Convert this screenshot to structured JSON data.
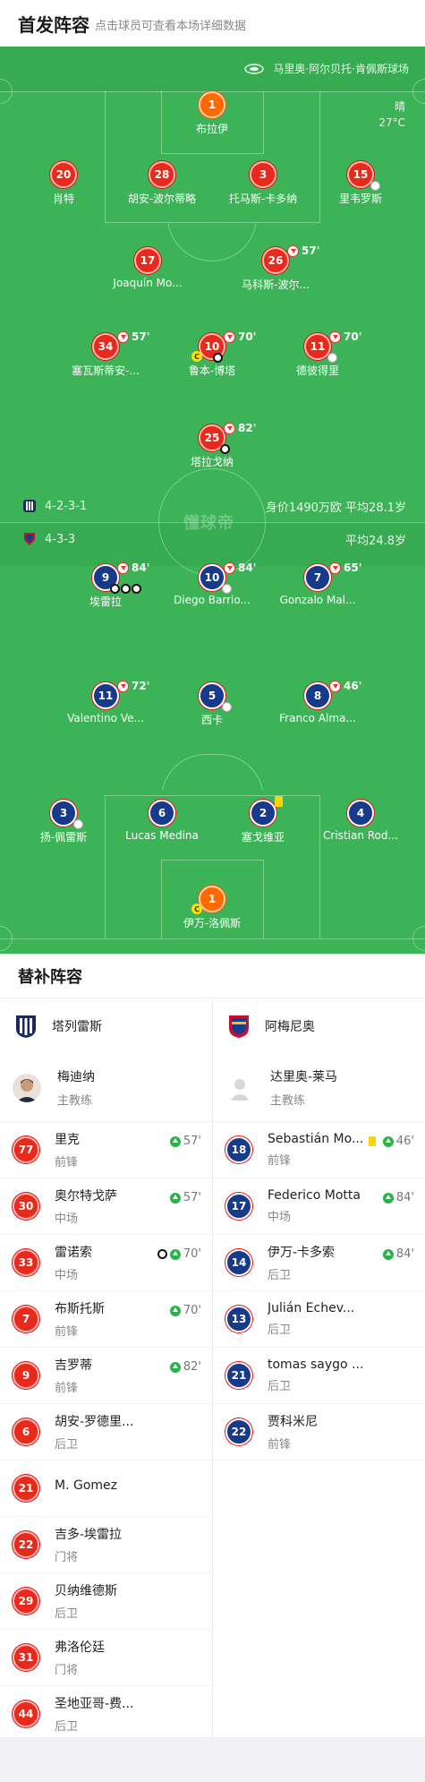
{
  "header": {
    "title": "首发阵容",
    "subtitle": "点击球员可查看本场详细数据"
  },
  "pitch": {
    "venue": "马里奥·阿尔贝托·肯佩斯球场",
    "weather": {
      "condition": "晴",
      "temp": "27°C"
    },
    "watermark": "懂球帝",
    "home_team": {
      "formation": "4-2-3-1",
      "stats": "身价1490万欧 平均28.1岁"
    },
    "away_team": {
      "formation": "4-3-3",
      "stats": "平均24.8岁"
    },
    "home_players": [
      {
        "num": "1",
        "name": "布拉伊",
        "type": "gk"
      },
      {
        "num": "20",
        "name": "肖特",
        "type": "home"
      },
      {
        "num": "28",
        "name": "胡安-波尔蒂略",
        "type": "home"
      },
      {
        "num": "3",
        "name": "托马斯-卡多纳",
        "type": "home"
      },
      {
        "num": "15",
        "name": "里韦罗斯",
        "type": "home"
      },
      {
        "num": "17",
        "name": "Joaquín Mo...",
        "type": "home"
      },
      {
        "num": "26",
        "name": "马科斯-波尔...",
        "type": "home",
        "sub_min": "57'"
      },
      {
        "num": "34",
        "name": "塞瓦斯蒂安-...",
        "type": "home",
        "sub_min": "57'"
      },
      {
        "num": "10",
        "name": "鲁本-博塔",
        "type": "home",
        "sub_min": "70'"
      },
      {
        "num": "11",
        "name": "德彼得里",
        "type": "home",
        "sub_min": "70'"
      },
      {
        "num": "25",
        "name": "塔拉戈纳",
        "type": "home",
        "sub_min": "82'"
      }
    ],
    "away_players": [
      {
        "num": "9",
        "name": "埃雷拉",
        "type": "away",
        "sub_min": "84'"
      },
      {
        "num": "10",
        "name": "Diego Barrio...",
        "type": "away",
        "sub_min": "84'"
      },
      {
        "num": "7",
        "name": "Gonzalo Mal...",
        "type": "away",
        "sub_min": "65'"
      },
      {
        "num": "11",
        "name": "Valentino Ve...",
        "type": "away",
        "sub_min": "72'"
      },
      {
        "num": "5",
        "name": "西卡",
        "type": "away"
      },
      {
        "num": "8",
        "name": "Franco Alma...",
        "type": "away",
        "sub_min": "46'"
      },
      {
        "num": "3",
        "name": "扬-佩雷斯",
        "type": "away"
      },
      {
        "num": "6",
        "name": "Lucas Medina",
        "type": "away"
      },
      {
        "num": "2",
        "name": "塞戈维亚",
        "type": "away"
      },
      {
        "num": "4",
        "name": "Cristian Rod...",
        "type": "away"
      },
      {
        "num": "1",
        "name": "伊万-洛佩斯",
        "type": "gk"
      }
    ],
    "captain_label": "C"
  },
  "subs": {
    "title": "替补阵容",
    "home": {
      "team_name": "塔列雷斯",
      "coach": {
        "name": "梅迪纳",
        "role": "主教练"
      },
      "players": [
        {
          "num": "77",
          "name": "里克",
          "pos": "前锋",
          "min": "57'"
        },
        {
          "num": "30",
          "name": "奥尔特戈萨",
          "pos": "中场",
          "min": "57'"
        },
        {
          "num": "33",
          "name": "雷诺索",
          "pos": "中场",
          "min": "70'"
        },
        {
          "num": "7",
          "name": "布斯托斯",
          "pos": "前锋",
          "min": "70'"
        },
        {
          "num": "9",
          "name": "吉罗蒂",
          "pos": "前锋",
          "min": "82'"
        },
        {
          "num": "6",
          "name": "胡安-罗德里...",
          "pos": "后卫",
          "min": ""
        },
        {
          "num": "21",
          "name": "M. Gomez",
          "pos": "",
          "min": ""
        },
        {
          "num": "22",
          "name": "吉多-埃雷拉",
          "pos": "门将",
          "min": ""
        },
        {
          "num": "29",
          "name": "贝纳维德斯",
          "pos": "后卫",
          "min": ""
        },
        {
          "num": "31",
          "name": "弗洛伦廷",
          "pos": "门将",
          "min": ""
        },
        {
          "num": "44",
          "name": "圣地亚哥-费...",
          "pos": "后卫",
          "min": ""
        }
      ]
    },
    "away": {
      "team_name": "阿梅尼奥",
      "coach": {
        "name": "达里奥-莱马",
        "role": "主教练"
      },
      "players": [
        {
          "num": "18",
          "name": "Sebastián Mo...",
          "pos": "前锋",
          "min": "46'"
        },
        {
          "num": "17",
          "name": "Federico Motta",
          "pos": "中场",
          "min": "84'"
        },
        {
          "num": "14",
          "name": "伊万-卡多索",
          "pos": "后卫",
          "min": "84'"
        },
        {
          "num": "13",
          "name": "Julián Echev...",
          "pos": "后卫",
          "min": ""
        },
        {
          "num": "21",
          "name": "tomas saygo ...",
          "pos": "后卫",
          "min": ""
        },
        {
          "num": "22",
          "name": "贾科米尼",
          "pos": "前锋",
          "min": ""
        }
      ]
    }
  }
}
